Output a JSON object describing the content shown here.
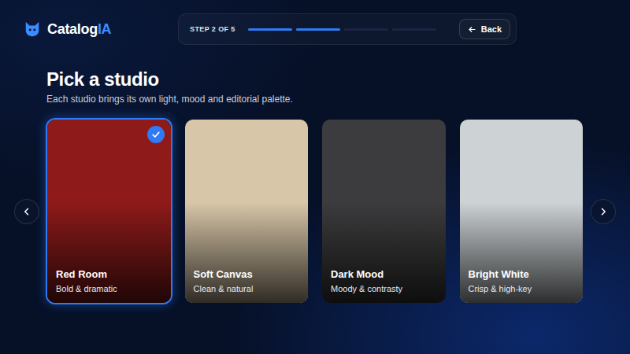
{
  "brand": {
    "name": "Catalog",
    "accent": "IA"
  },
  "stepper": {
    "label": "STEP 2 OF 5",
    "segments": [
      {
        "filled": true
      },
      {
        "filled": true
      },
      {
        "filled": false
      },
      {
        "filled": false
      }
    ]
  },
  "back_button": {
    "label": "Back"
  },
  "heading": {
    "title": "Pick a studio",
    "subtitle": "Each studio brings its own light, mood and editorial palette."
  },
  "studios": [
    {
      "name": "Red Room",
      "description": "Bold & dramatic",
      "selected": true,
      "color": "#8e1a1a"
    },
    {
      "name": "Soft Canvas",
      "description": "Clean & natural",
      "selected": false,
      "color": "#d8c6a8"
    },
    {
      "name": "Dark Mood",
      "description": "Moody & contrasty",
      "selected": false,
      "color": "#3c3c3e"
    },
    {
      "name": "Bright White",
      "description": "Crisp & high-key",
      "selected": false,
      "color": "#cdd2d5"
    }
  ]
}
